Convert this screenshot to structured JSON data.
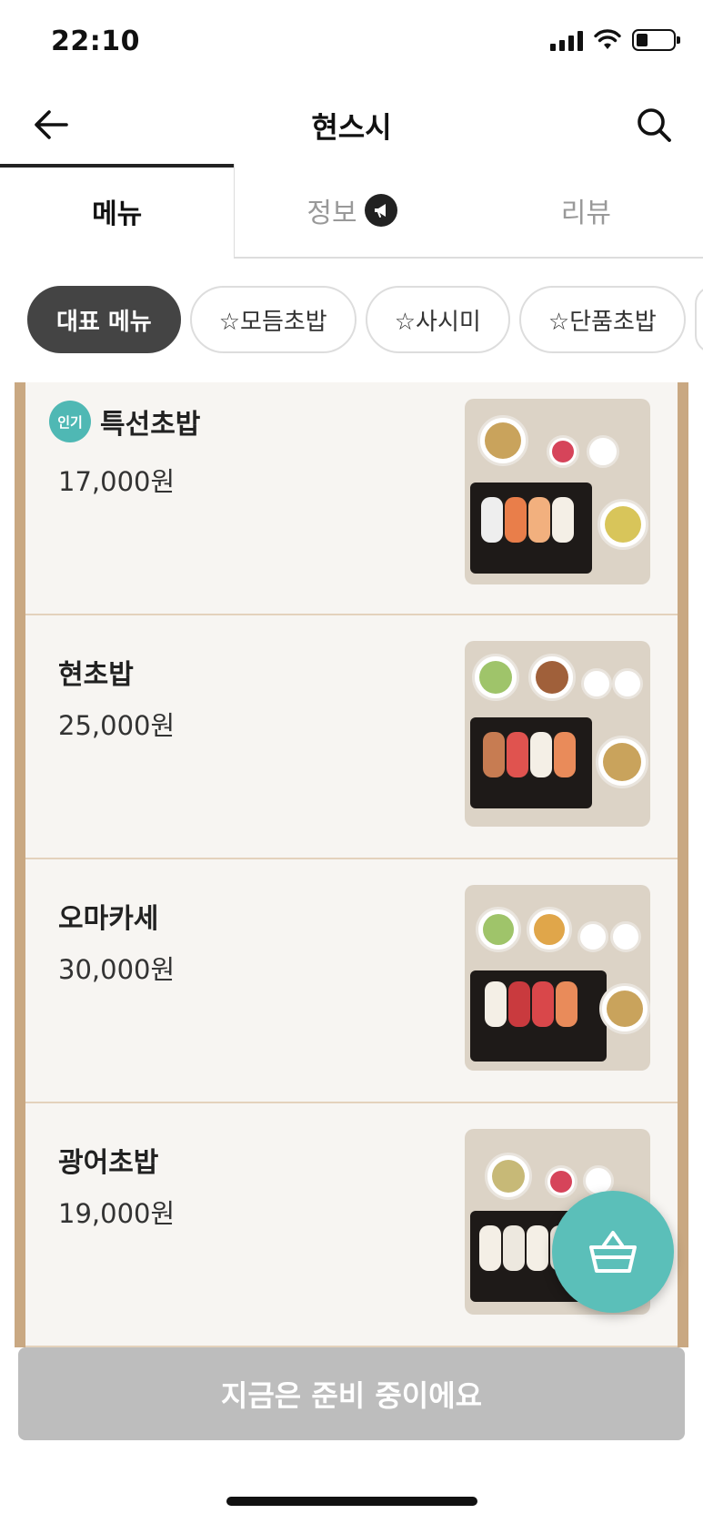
{
  "status_bar": {
    "time": "22:10",
    "signal_icon": "signal-bars-icon",
    "wifi_icon": "wifi-icon",
    "battery_icon": "battery-icon"
  },
  "header": {
    "title": "현스시",
    "back_icon": "arrow-left-icon",
    "search_icon": "search-icon"
  },
  "tabs": [
    {
      "label": "메뉴",
      "active": true
    },
    {
      "label": "정보",
      "active": false,
      "icon": "megaphone-icon"
    },
    {
      "label": "리뷰",
      "active": false
    }
  ],
  "chips": [
    {
      "label": "대표 메뉴",
      "active": true
    },
    {
      "label": "☆모듬초밥",
      "active": false
    },
    {
      "label": "☆사시미",
      "active": false
    },
    {
      "label": "☆단품초밥",
      "active": false
    }
  ],
  "menu_items": [
    {
      "badge": "인기",
      "name": "특선초밥",
      "price": "17,000원"
    },
    {
      "name": "현초밥",
      "price": "25,000원"
    },
    {
      "name": "오마카세",
      "price": "30,000원"
    },
    {
      "name": "광어초밥",
      "price": "19,000원"
    }
  ],
  "cart": {
    "icon": "shopping-basket-icon"
  },
  "order_button": {
    "label": "지금은 준비 중이에요"
  },
  "colors": {
    "accent": "#5bbfb9",
    "frame": "#c9a882",
    "disabled": "#bdbdbd",
    "chip_active": "#444444"
  }
}
